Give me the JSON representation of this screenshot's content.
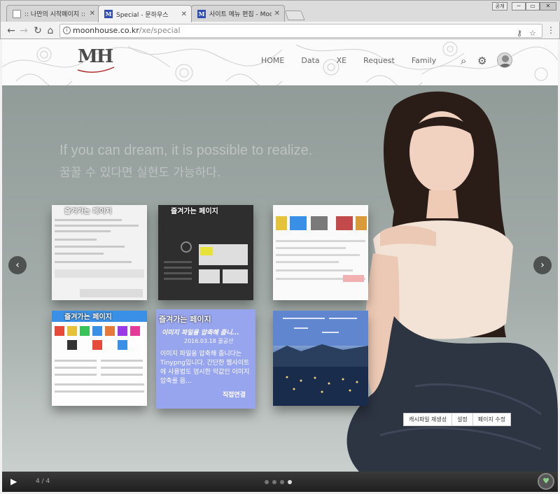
{
  "browser": {
    "tabs": [
      {
        "title": ":: 나만의 시작페이지 ::",
        "favicon": "document-icon"
      },
      {
        "title": "Special - 문하우스",
        "favicon": "m-logo-icon"
      },
      {
        "title": "사이트 메뉴 편집 - Moonh",
        "favicon": "m-logo-icon"
      }
    ],
    "profile_label": "공개",
    "url_host": "moonhouse.co.kr",
    "url_path": "/xe/special"
  },
  "site": {
    "logo_text": "MH",
    "menu": [
      "HOME",
      "Data",
      "XE",
      "Request",
      "Family"
    ]
  },
  "hero": {
    "tagline_en": "If you can dream, it is possible to realize.",
    "tagline_ko": "꿈꿀 수 있다면 실현도 가능하다.",
    "card": {
      "title": "즐겨가는 페이지",
      "headline": "이미지 파일을 압축해 줍니...",
      "meta": "2016.03.18 꿀공산",
      "description": "이미지 파일을 압축해 줍니다는 Tinypng입니다. 간단한 웹사이트에 사용법도 엄시한 악값인 이미지 압축를 읍...",
      "link": "직접연결"
    },
    "thumb_captions": [
      "즐겨가는 페이지",
      "즐겨가는 페이지",
      "즐겨가는 페이지"
    ]
  },
  "admin_bar": [
    "캐시파일 재생성",
    "설정",
    "페이지 수정"
  ],
  "player": {
    "counter": "4 / 4",
    "slide_count": 4,
    "current_slide": 4
  }
}
